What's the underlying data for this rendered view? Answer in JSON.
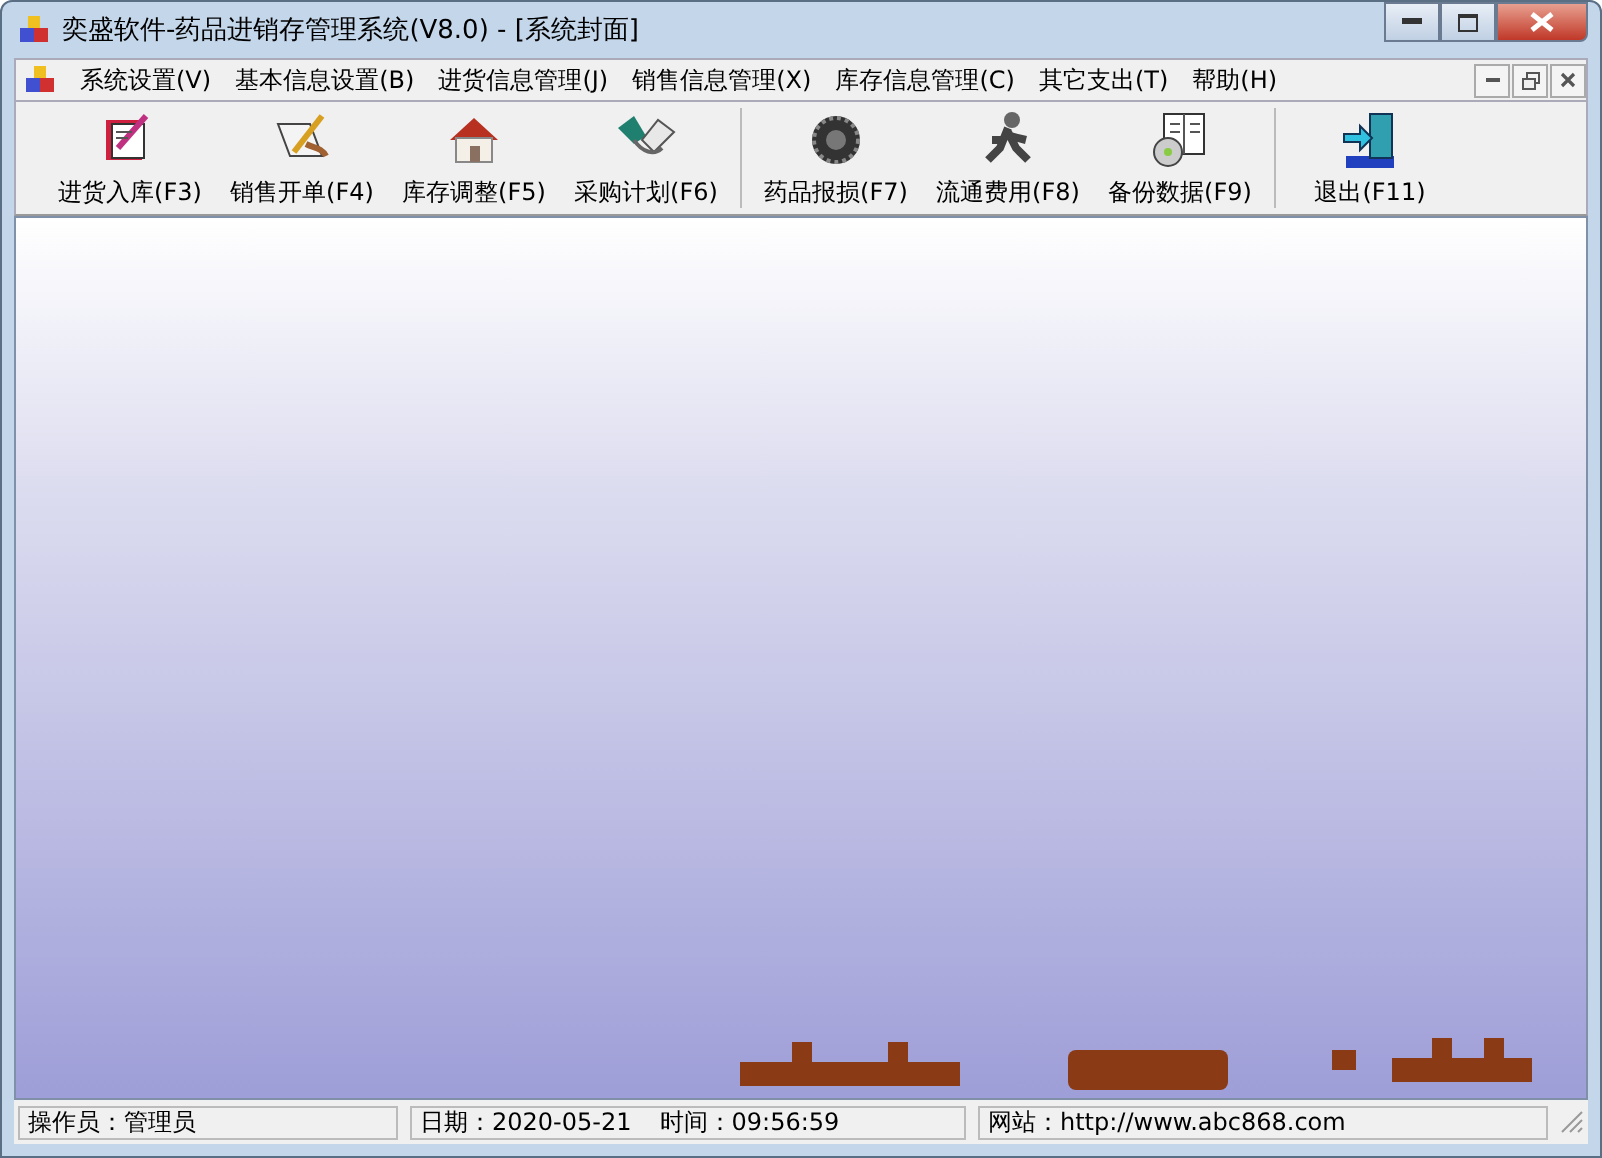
{
  "window": {
    "title": "奕盛软件-药品进销存管理系统(V8.0) - [系统封面]"
  },
  "menu": [
    "系统设置(V)",
    "基本信息设置(B)",
    "进货信息管理(J)",
    "销售信息管理(X)",
    "库存信息管理(C)",
    "其它支出(T)",
    "帮助(H)"
  ],
  "toolbar": {
    "groups": [
      [
        "进货入库(F3)",
        "销售开单(F4)",
        "库存调整(F5)",
        "采购计划(F6)"
      ],
      [
        "药品报损(F7)",
        "流通费用(F8)",
        "备份数据(F9)"
      ],
      [
        "退出(F11)"
      ]
    ]
  },
  "status_bar": {
    "operator": "操作员：管理员",
    "date": "日期：2020-05-21",
    "time": "时间：09:56:59",
    "website": "网站：http://www.abc868.com"
  }
}
